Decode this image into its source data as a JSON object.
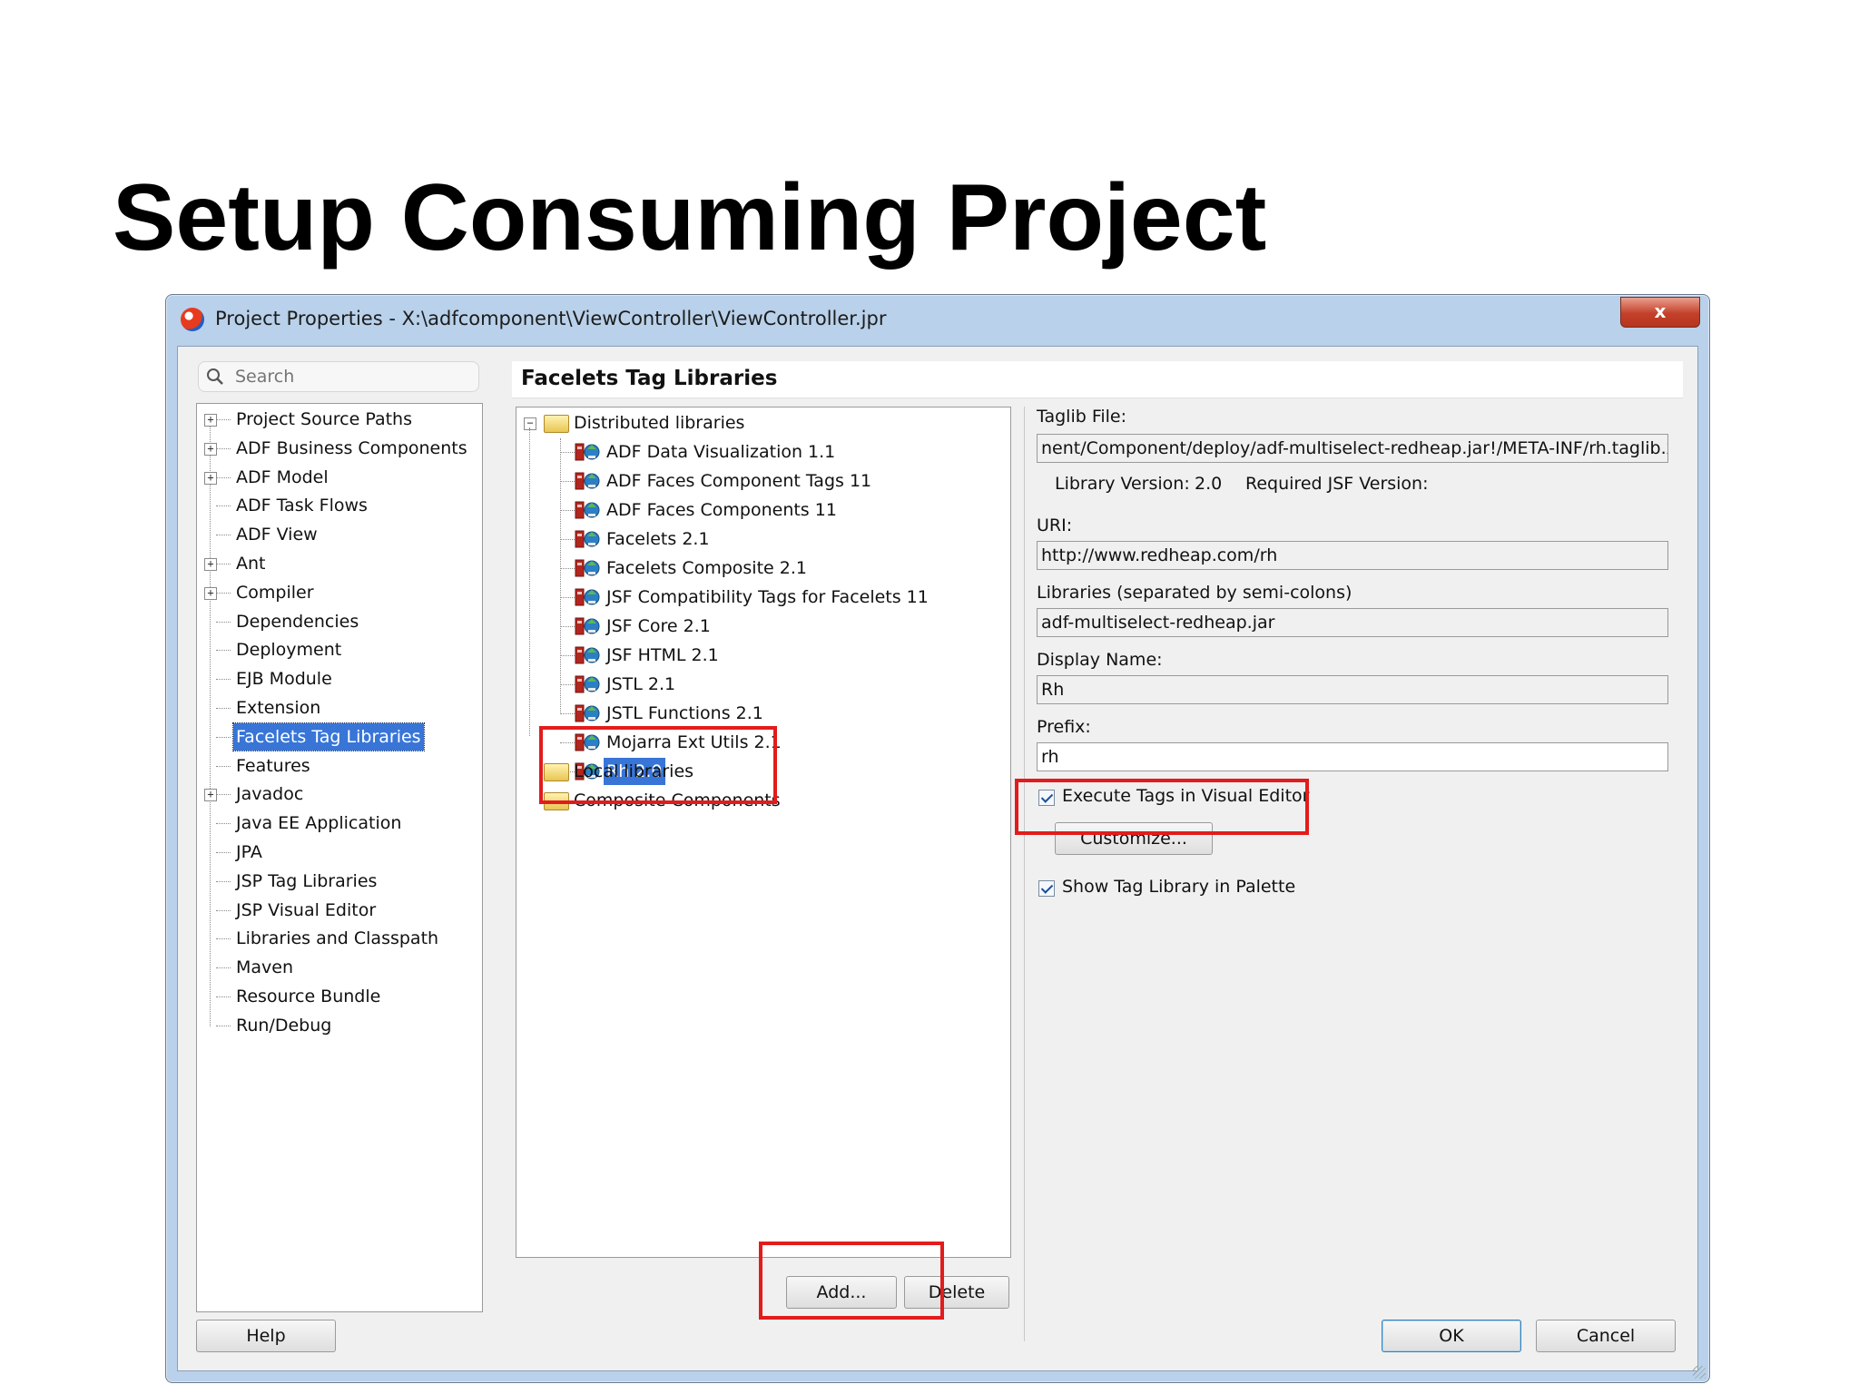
{
  "slide": {
    "title": "Setup Consuming Project"
  },
  "window": {
    "title": "Project Properties - X:\\adfcomponent\\ViewController\\ViewController.jpr",
    "close_label": "x"
  },
  "search": {
    "placeholder": "Search"
  },
  "nav": {
    "items": [
      {
        "label": "Project Source Paths",
        "expandable": true
      },
      {
        "label": "ADF Business Components",
        "expandable": true
      },
      {
        "label": "ADF Model",
        "expandable": true
      },
      {
        "label": "ADF Task Flows",
        "expandable": false
      },
      {
        "label": "ADF View",
        "expandable": false
      },
      {
        "label": "Ant",
        "expandable": true
      },
      {
        "label": "Compiler",
        "expandable": true
      },
      {
        "label": "Dependencies",
        "expandable": false
      },
      {
        "label": "Deployment",
        "expandable": false
      },
      {
        "label": "EJB Module",
        "expandable": false
      },
      {
        "label": "Extension",
        "expandable": false
      },
      {
        "label": "Facelets Tag Libraries",
        "expandable": false,
        "selected": true
      },
      {
        "label": "Features",
        "expandable": false
      },
      {
        "label": "Javadoc",
        "expandable": true
      },
      {
        "label": "Java EE Application",
        "expandable": false
      },
      {
        "label": "JPA",
        "expandable": false
      },
      {
        "label": "JSP Tag Libraries",
        "expandable": false
      },
      {
        "label": "JSP Visual Editor",
        "expandable": false
      },
      {
        "label": "Libraries and Classpath",
        "expandable": false
      },
      {
        "label": "Maven",
        "expandable": false
      },
      {
        "label": "Resource Bundle",
        "expandable": false
      },
      {
        "label": "Run/Debug",
        "expandable": false
      }
    ]
  },
  "page": {
    "title": "Facelets Tag Libraries"
  },
  "libraries": {
    "distributed_label": "Distributed libraries",
    "items": [
      {
        "label": "ADF Data Visualization 1.1"
      },
      {
        "label": "ADF Faces Component Tags 11"
      },
      {
        "label": "ADF Faces Components 11"
      },
      {
        "label": "Facelets 2.1"
      },
      {
        "label": "Facelets Composite 2.1"
      },
      {
        "label": "JSF Compatibility Tags for Facelets 11"
      },
      {
        "label": "JSF Core 2.1"
      },
      {
        "label": "JSF HTML 2.1"
      },
      {
        "label": "JSTL 2.1"
      },
      {
        "label": "JSTL Functions 2.1"
      },
      {
        "label": "Mojarra Ext Utils 2.1"
      },
      {
        "label": "Rh 2.0",
        "selected": true
      }
    ],
    "local_label": "Local libraries",
    "composite_label": "Composite Components",
    "add_label": "Add...",
    "delete_label": "Delete"
  },
  "details": {
    "taglib_file_label": "Taglib File:",
    "taglib_file_value": "nent/Component/deploy/adf-multiselect-redheap.jar!/META-INF/rh.taglib.xml",
    "library_version_label": "Library Version:",
    "library_version_value": "2.0",
    "required_jsf_label": "Required JSF Version:",
    "uri_label": "URI:",
    "uri_value": "http://www.redheap.com/rh",
    "libraries_label": "Libraries (separated by semi-colons)",
    "libraries_value": "adf-multiselect-redheap.jar",
    "display_name_label": "Display Name:",
    "display_name_value": "Rh",
    "prefix_label": "Prefix:",
    "prefix_value": "rh",
    "execute_tags_label": "Execute Tags in Visual Editor",
    "execute_tags_checked": true,
    "customize_label": "Customize...",
    "show_in_palette_label": "Show Tag Library in Palette",
    "show_in_palette_checked": true
  },
  "footer": {
    "help_label": "Help",
    "ok_label": "OK",
    "cancel_label": "Cancel"
  },
  "colors": {
    "highlight": "#e21c1c",
    "selection": "#3875d7",
    "frame": "#b9d1ea"
  }
}
